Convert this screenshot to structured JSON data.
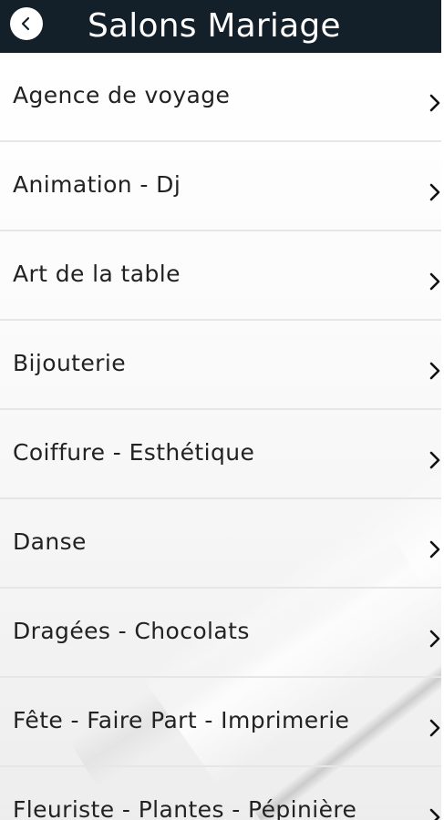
{
  "header": {
    "title": "Salons Mariage",
    "back_icon": "chevron-left-icon",
    "background": "#13202a"
  },
  "list": {
    "chevron_icon": "chevron-right-icon",
    "items": [
      {
        "label": "Agence de voyage"
      },
      {
        "label": "Animation - Dj"
      },
      {
        "label": "Art de la table"
      },
      {
        "label": "Bijouterie"
      },
      {
        "label": "Coiffure - Esthétique"
      },
      {
        "label": "Danse"
      },
      {
        "label": "Dragées - Chocolats"
      },
      {
        "label": "Fête - Faire Part - Imprimerie"
      },
      {
        "label": "Fleuriste - Plantes - Pépinière"
      }
    ]
  }
}
